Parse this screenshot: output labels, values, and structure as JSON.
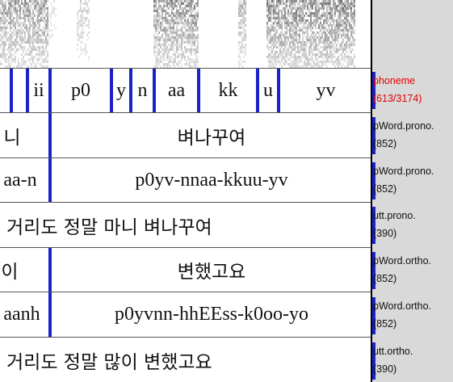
{
  "tiers": [
    {
      "name": "phoneme",
      "count": "(613/3174)",
      "selected": true,
      "script": "roman",
      "segments": [
        "",
        "",
        "ii",
        "p0",
        "y",
        "n",
        "aa",
        "kk",
        "u",
        "yv"
      ]
    },
    {
      "name": "pWord.prono.",
      "count": "(852)",
      "script": "hangul",
      "segments": [
        "니",
        "벼나꾸여"
      ]
    },
    {
      "name": "pWord.prono.",
      "count": "(852)",
      "script": "roman",
      "segments": [
        "aa-n",
        "p0yv-nnaa-kkuu-yv"
      ]
    },
    {
      "name": "utt.prono.",
      "count": "(390)",
      "script": "hangul",
      "segments": [
        "거리도 정말 마니 벼나꾸여"
      ]
    },
    {
      "name": "pWord.ortho.",
      "count": "(852)",
      "script": "hangul",
      "segments": [
        "이",
        "변했고요"
      ]
    },
    {
      "name": "pWord.ortho.",
      "count": "(852)",
      "script": "roman",
      "segments": [
        "aanh",
        "p0yvnn-hhEEss-k0oo-yo"
      ]
    },
    {
      "name": "utt.ortho.",
      "count": "(390)",
      "script": "hangul",
      "segments": [
        "거리도 정말 많이 변했고요"
      ]
    }
  ],
  "colors": {
    "boundary": "#1a22c8",
    "selected_label": "#e00000",
    "sidebar": "#d9d9d9"
  }
}
